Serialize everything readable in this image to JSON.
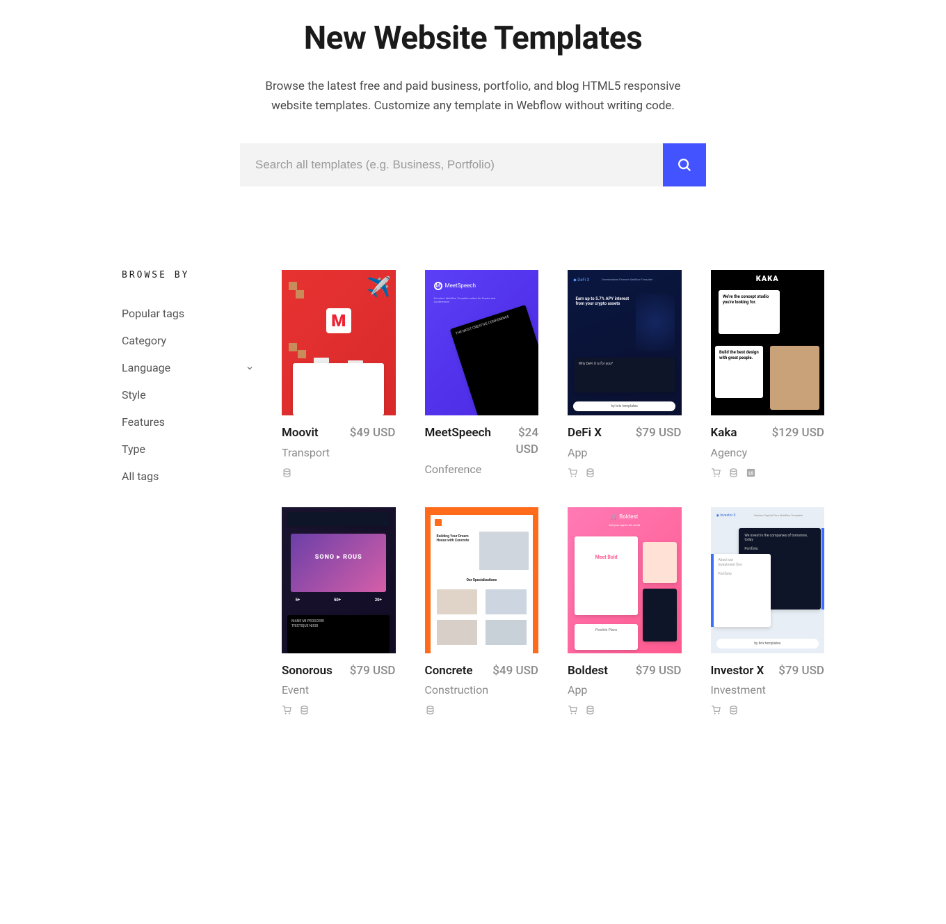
{
  "hero": {
    "title": "New Website Templates",
    "subtitle": "Browse the latest free and paid business, portfolio, and blog HTML5 responsive website templates. Customize any template in Webflow without writing code."
  },
  "search": {
    "placeholder": "Search all templates (e.g. Business, Portfolio)"
  },
  "sidebar": {
    "heading": "BROWSE BY",
    "items": [
      {
        "label": "Popular tags",
        "expandable": false
      },
      {
        "label": "Category",
        "expandable": false
      },
      {
        "label": "Language",
        "expandable": true
      },
      {
        "label": "Style",
        "expandable": false
      },
      {
        "label": "Features",
        "expandable": false
      },
      {
        "label": "Type",
        "expandable": false
      },
      {
        "label": "All tags",
        "expandable": false
      }
    ]
  },
  "templates": [
    {
      "name": "Moovit",
      "category": "Transport",
      "price": "$49 USD",
      "icons": [
        "cms"
      ],
      "thumb": "red"
    },
    {
      "name": "MeetSpeech",
      "category": "Conference",
      "price": "$24 USD",
      "icons": [],
      "thumb": "purple"
    },
    {
      "name": "DeFi X",
      "category": "App",
      "price": "$79 USD",
      "icons": [
        "ecommerce",
        "cms"
      ],
      "thumb": "navy"
    },
    {
      "name": "Kaka",
      "category": "Agency",
      "price": "$129 USD",
      "icons": [
        "ecommerce",
        "cms",
        "uikit"
      ],
      "thumb": "bw"
    },
    {
      "name": "Sonorous",
      "category": "Event",
      "price": "$79 USD",
      "icons": [
        "ecommerce",
        "cms"
      ],
      "thumb": "dark"
    },
    {
      "name": "Concrete",
      "category": "Construction",
      "price": "$49 USD",
      "icons": [
        "cms"
      ],
      "thumb": "orange"
    },
    {
      "name": "Boldest",
      "category": "App",
      "price": "$79 USD",
      "icons": [
        "ecommerce",
        "cms"
      ],
      "thumb": "pink"
    },
    {
      "name": "Investor X",
      "category": "Investment",
      "price": "$79 USD",
      "icons": [
        "ecommerce",
        "cms"
      ],
      "thumb": "light"
    }
  ],
  "thumb_text": {
    "red_logo": "M",
    "purple_brand": "MeetSpeech",
    "purple_sub": "Premium Webflow Template suited for Events and Conferences",
    "navy_brand": "DeFi X",
    "navy_tag": "Decentralized Finance Webflow Template",
    "navy_headline": "Earn up to 5.7% APY interest from your crypto assets",
    "navy_footer": "by brix templates",
    "bw_brand": "KAKA",
    "bw_panel1": "We're the concept studio you're looking for.",
    "bw_panel2": "Build the best design with great people.",
    "dark_title": "SONO ▸ ROUS",
    "dark_s1": "5+",
    "dark_s2": "50+",
    "dark_s3": "20+",
    "orange_title": "Our Specializations",
    "pink_brand": "🛒 Boldest",
    "pink_sub": "Sell your app to the world",
    "pink_mid": "Meet Bold",
    "light_brand": "Investor X",
    "light_tag": "Venture Capital Firm Webflow Template",
    "light_panel": "We invest in the companies of tomorrow, today",
    "light_footer": "by brix templates"
  }
}
